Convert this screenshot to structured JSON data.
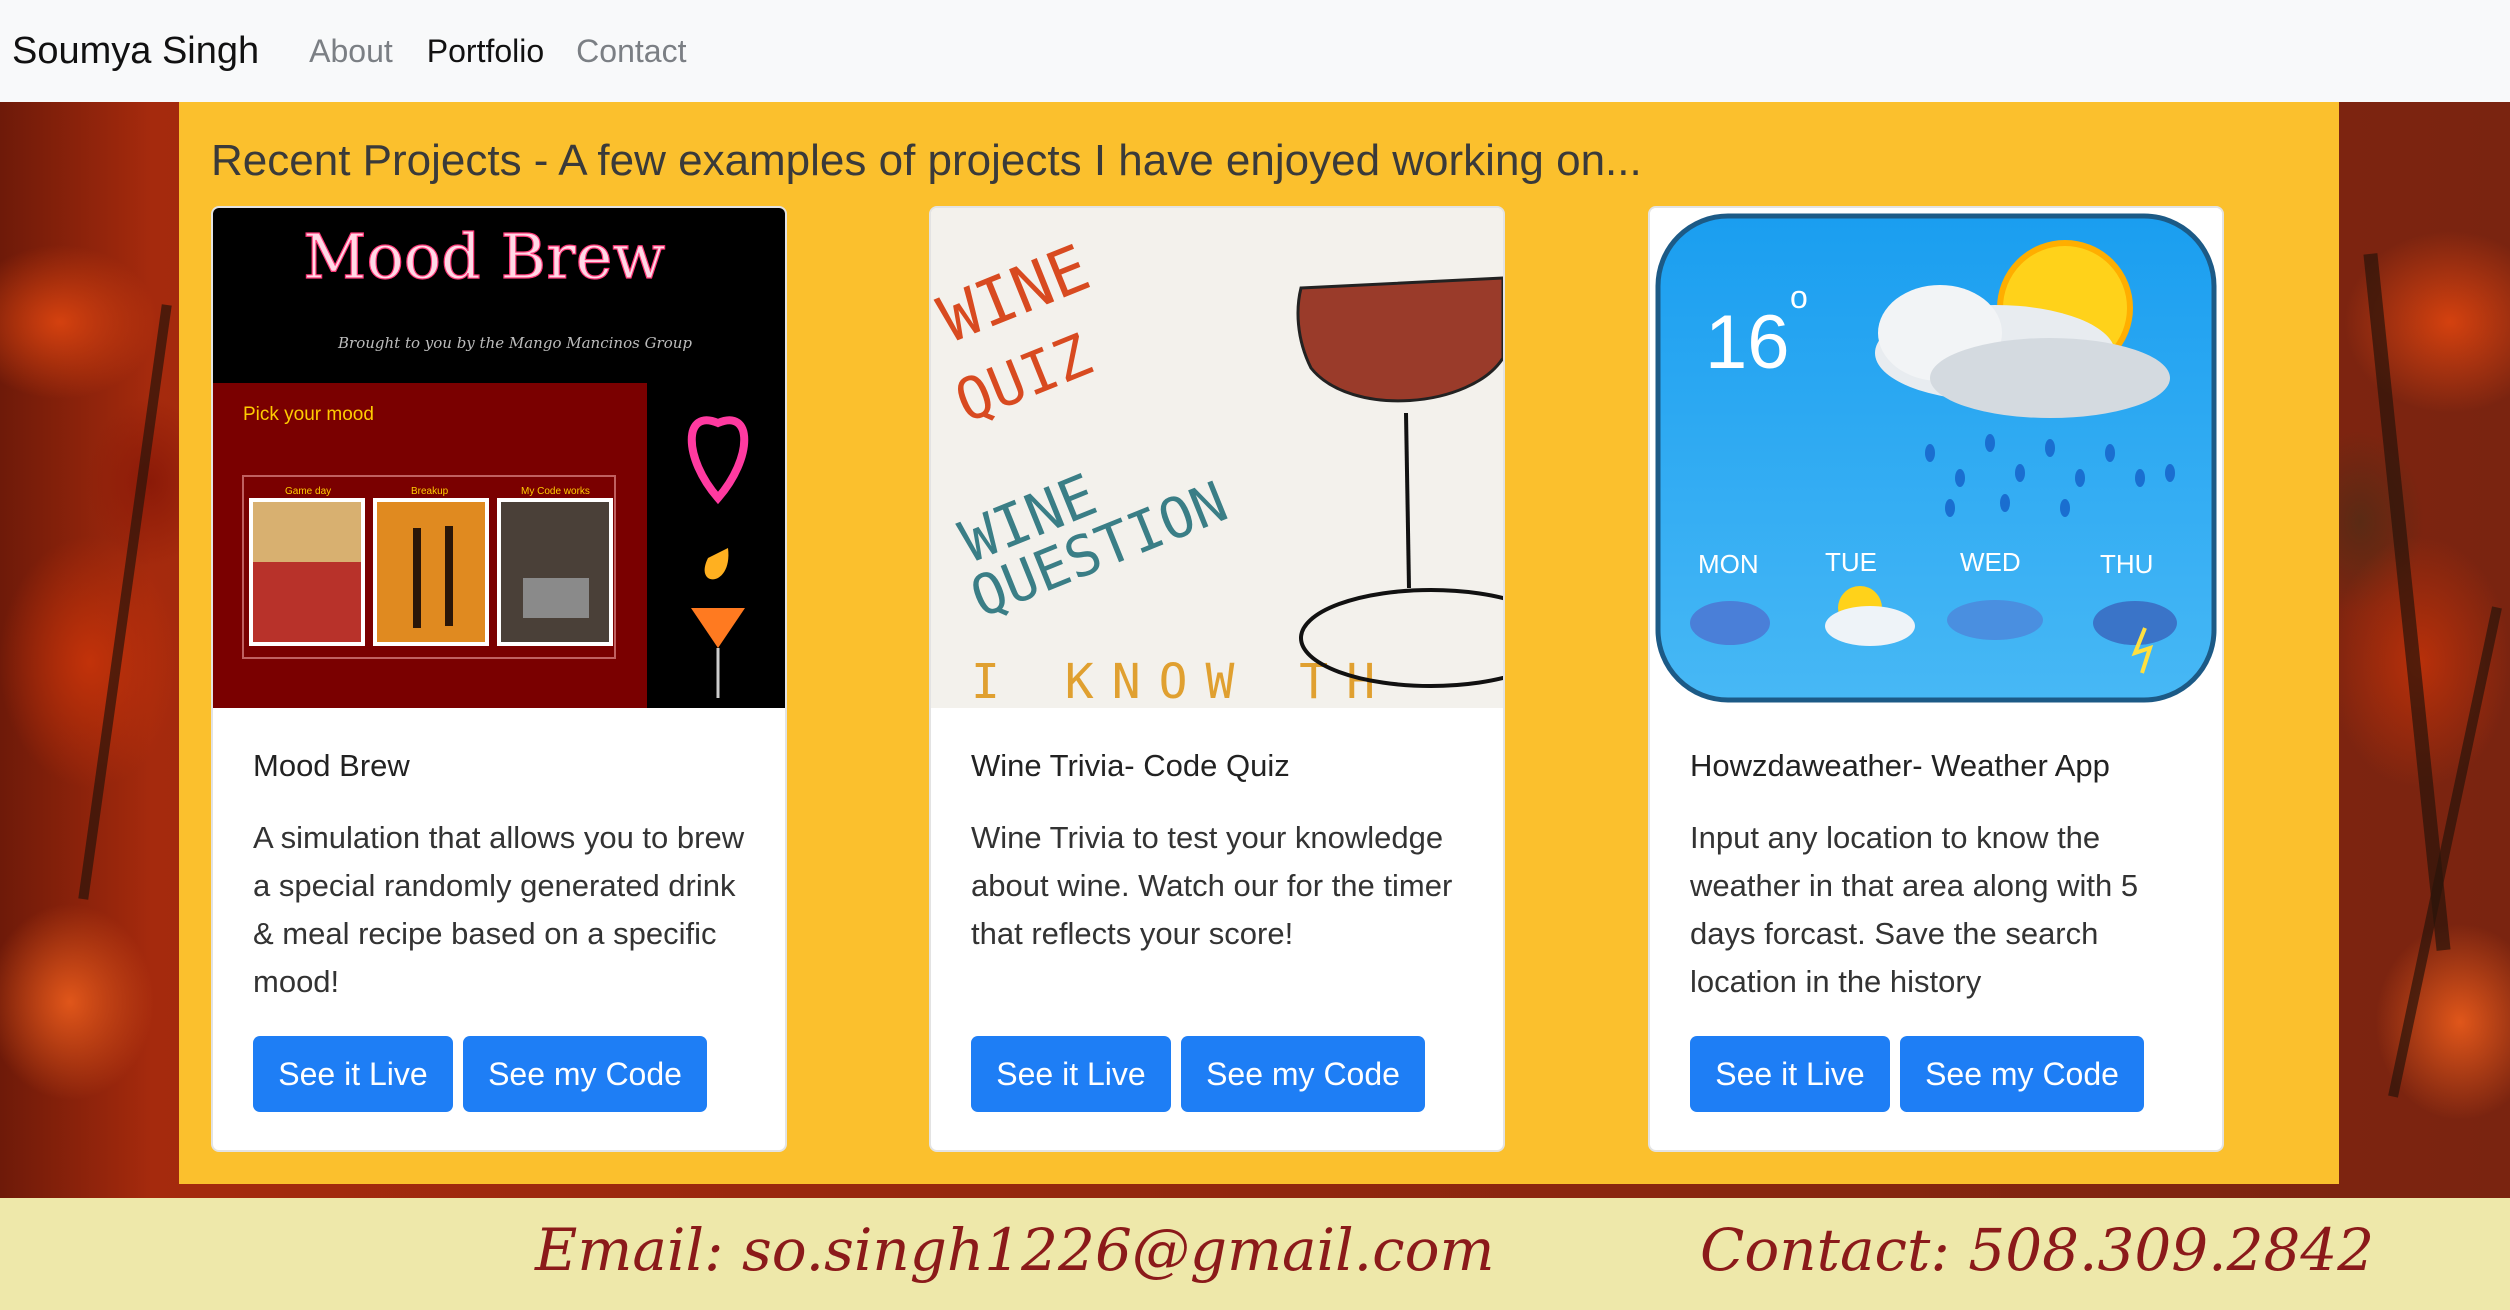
{
  "nav": {
    "brand": "Soumya Singh",
    "links": [
      "About",
      "Portfolio",
      "Contact"
    ],
    "active": "Portfolio"
  },
  "main": {
    "heading": "Recent Projects - A few examples of projects I have enjoyed working on...",
    "cards": [
      {
        "title": "Mood Brew",
        "text": "A simulation that allows you to brew a special randomly generated drink & meal recipe based on a specific mood!",
        "live_label": "See it Live",
        "code_label": "See my Code",
        "image": {
          "title": "Mood Brew",
          "subtitle": "Brought to you by the Mango Mancinos Group",
          "prompt": "Pick your mood",
          "moods": [
            "Game day",
            "Breakup",
            "My Code works"
          ]
        }
      },
      {
        "title": "Wine Trivia- Code Quiz",
        "text": "Wine Trivia to test your knowledge about wine. Watch our for the timer that reflects your score!",
        "live_label": "See it Live",
        "code_label": "See my Code",
        "image": {
          "line1": "WINE",
          "line2": "QUIZ",
          "line3": "WINE",
          "line4": "QUESTION",
          "line5": "I KNOW TH"
        }
      },
      {
        "title": "Howzdaweather- Weather App",
        "text": "Input any location to know the weather in that area along with 5 days forcast. Save the search location in the history",
        "live_label": "See it Live",
        "code_label": "See my Code",
        "image": {
          "temp": "16",
          "degree": "o",
          "days": [
            "MON",
            "TUE",
            "WED",
            "THU"
          ]
        }
      }
    ]
  },
  "footer": {
    "email": "Email: so.singh1226@gmail.com",
    "contact": "Contact: 508.309.2842"
  },
  "colors": {
    "panel": "#fbc02d",
    "button": "#1e7ef5",
    "footer_bg": "#eee8aa",
    "footer_text": "#8b1a1a",
    "navbar": "#f8f9fa"
  }
}
